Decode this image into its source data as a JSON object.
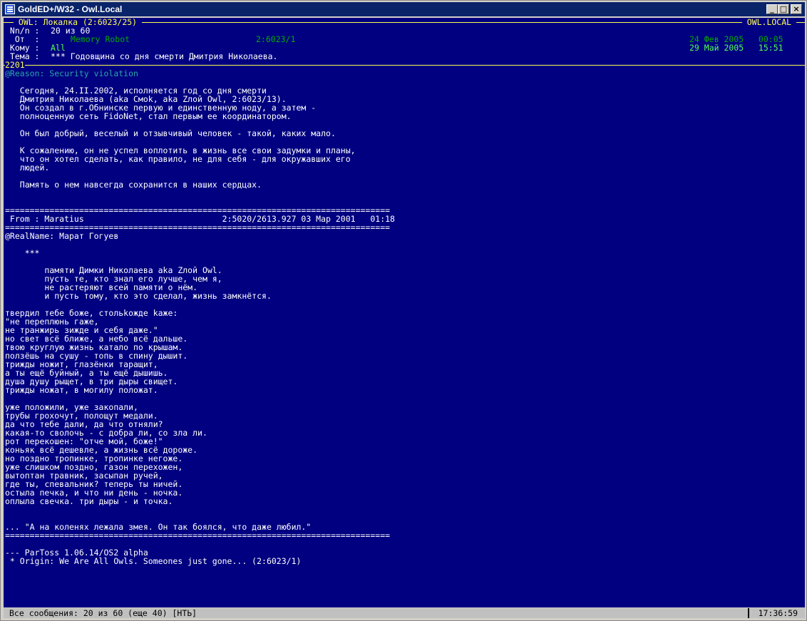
{
  "window": {
    "title": "GoldED+/W32 - Owl.Local"
  },
  "header": {
    "area_title": " OWL: Локалка (2:6023/25) ",
    "station": " OWL.LOCAL ",
    "msgnum_label": " Nn/n :",
    "msgnum_value": "20 из 60",
    "from_label": "  От  :",
    "from_name": "Memory Robot",
    "from_addr": "2:6023/1",
    "from_date": "24 Фев 2005   00:05",
    "to_label": " Кому :",
    "to_name": "All",
    "to_date": "29 Май 2005   15:51",
    "subj_label": " Тема :",
    "subj_value": "*** Годовщина со дня смерти Дмитрия Николаева.",
    "reply_num": "2201"
  },
  "body": {
    "reason": "@Reason: Security violation",
    "lines": [
      "",
      "   Сегодня, 24.II.2002, исполняется год со дня смерти",
      "   Дмитрия Николаева (aka Cмok, aka Zлoй Owl, 2:6023/13).",
      "   Он создал в г.Обнинске первую и единственную ноду, а затем -",
      "   полноценную сеть FidoNet, стал первым ее координатором.",
      "",
      "   Он был добрый, веселый и отзывчивый человек - такой, каких мало.",
      "",
      "   К сожалению, он не успел воплотить в жизнь все свои задумки и планы,",
      "   что он хотел сделать, как правило, не для себя - для окружавших его",
      "   людей.",
      "",
      "   Память о нем навсегда сохранится в наших сердцах.",
      "",
      "",
      "==============================================================================",
      " From : Maratius                            2:5020/2613.927 03 Мар 2001   01:18",
      "==============================================================================",
      "@RealName: Марат Гогуев",
      "",
      "    ***",
      "",
      "        памяти Димки Николаева aka Zлой Owl.",
      "        пусть те, кто знал его лучше, чем я,",
      "        не растеряют всей памяти о нём.",
      "        и пусть тому, кто это сделал, жизнь замкнётся.",
      "",
      "твердил тебе боже, стольkожде kаже:",
      "\"не переплюнь гаже,",
      "не транжирь зиждe и себя даже.\"",
      "но свет всё ближе, а небо всё дальше.",
      "твою круглую жизнь катало по крышам.",
      "ползёшь на сушу - топь в спину дышит.",
      "трижды ножит, глазёнки таращит,",
      "а ты ещё буйный, а ты ещё дышишь.",
      "душа душу рыщет, в три дыры свищет.",
      "трижды ножат, в могилу положат.",
      "",
      "уже положили, уже закопали,",
      "трубы грохочут, полощут медали.",
      "да что тебе дали, да что отняли?",
      "какая-то сволочь - с добра ли, со зла ли.",
      "рот перекошен: \"отче мой, боже!\"",
      "коньяк всё дешевле, а жизнь всё дороже.",
      "но поздно тропинке, тропинке негоже.",
      "уже слишком поздно, газон перехожен,",
      "вытоптан травник, засыпан ручей,",
      "где ты, спевальник? теперь ты ничей.",
      "остыла печка, и что ни день - ночка.",
      "оплыла свечка. три дыры - и точка.",
      "",
      "",
      "... \"А на коленях лежала змея. Он так боялся, что даже любил.\"",
      "==============================================================================",
      "",
      "--- ParToss 1.06.14/OS2 alpha",
      " * Origin: We Are All Owls. Someones just gone... (2:6023/1)"
    ]
  },
  "status": {
    "left": "Все сообщения: 20 из 60 (еще 40) [НТЬ]",
    "time": "17:36:59"
  }
}
